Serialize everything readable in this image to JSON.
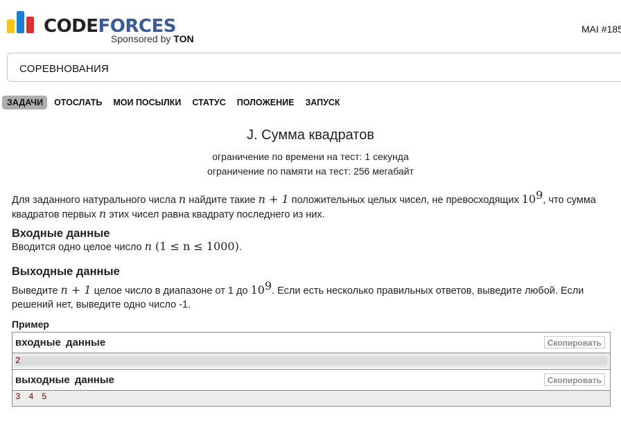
{
  "header": {
    "logo": {
      "text_code": "CODE",
      "text_forces": "FORCES",
      "sponsored_prefix": "Sponsored by",
      "sponsor": "TON",
      "colors": {
        "bar_yellow": "#f7c21a",
        "bar_blue": "#1d7ed2",
        "bar_red": "#d83332",
        "forces": "#3a5a9a"
      }
    },
    "user_info": "MAI #185"
  },
  "contest_box": {
    "label": "СОРЕВНОВАНИЯ"
  },
  "menu": {
    "items": [
      {
        "label": "ЗАДАЧИ",
        "active": true
      },
      {
        "label": "ОТОСЛАТЬ",
        "active": false
      },
      {
        "label": "МОИ ПОСЫЛКИ",
        "active": false
      },
      {
        "label": "СТАТУС",
        "active": false
      },
      {
        "label": "ПОЛОЖЕНИЕ",
        "active": false
      },
      {
        "label": "ЗАПУСК",
        "active": false
      }
    ]
  },
  "problem": {
    "title": "J. Сумма квадратов",
    "time_limit": "ограничение по времени на тест: 1 секунда",
    "memory_limit": "ограничение по памяти на тест: 256 мегабайт",
    "statement": {
      "t1": "Для заданного натурального числа ",
      "n": "n",
      "t2": " найдите такие ",
      "n_plus_1": "n + 1",
      "t3": " положительных целых чисел, не превосходящих ",
      "ten": "10",
      "nine": "9",
      "t4": ", что сумма квадратов первых ",
      "t5": " этих чисел равна квадрату последнего из них."
    },
    "input": {
      "title": "Входные данные",
      "t1": "Вводится одно целое число ",
      "n": "n",
      "constraint": " (1 ≤ n ≤ 1000)",
      "t2": "."
    },
    "output": {
      "title": "Выходные данные",
      "t1": "Выведите ",
      "n_plus_1": "n + 1",
      "t2": " целое число в диапазоне от 1 до ",
      "ten": "10",
      "nine": "9",
      "t3": ". Если есть несколько правильных ответов, выведите любой. Если решений нет, выведите одно число -1."
    }
  },
  "example": {
    "title": "Пример",
    "input_label": "входные данные",
    "output_label": "выходные данные",
    "copy_label": "Скопировать",
    "input_value": "2",
    "output_value": "3 4 5"
  }
}
